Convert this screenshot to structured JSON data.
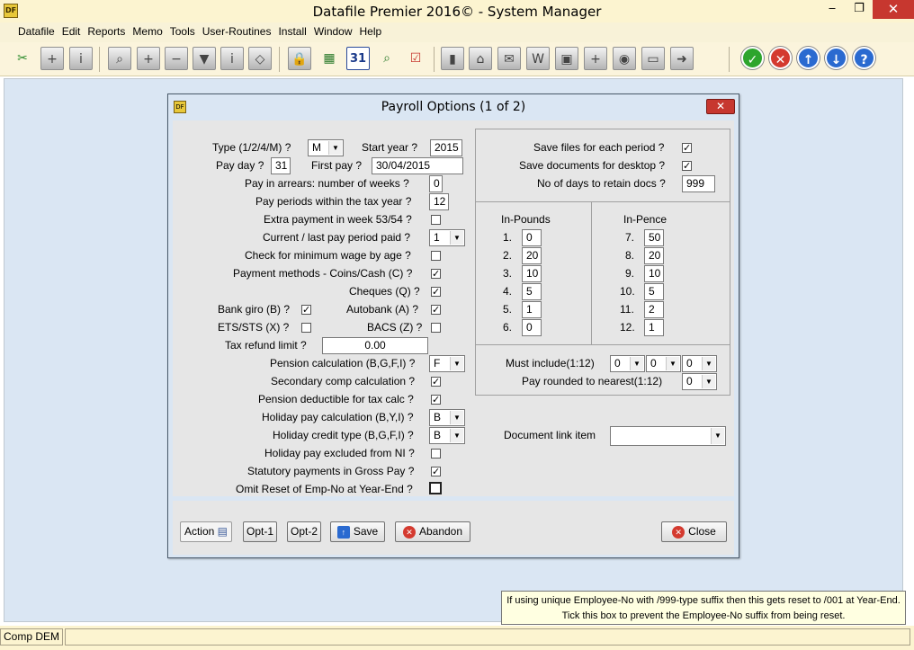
{
  "window": {
    "title": "Datafile  Premier 2016©  - System Manager",
    "app_icon_text": "DF"
  },
  "menu": [
    "Datafile",
    "Edit",
    "Reports",
    "Memo",
    "Tools",
    "User-Routines",
    "Install",
    "Window",
    "Help"
  ],
  "toolbar": {
    "calendar_day": "31"
  },
  "dialog": {
    "title": "Payroll Options (1 of 2)",
    "close_x": "✕",
    "left": {
      "type_label": "Type (1/2/4/M) ?",
      "type_value": "M",
      "start_year_label": "Start year ?",
      "start_year_value": "2015",
      "pay_day_label": "Pay day ?",
      "pay_day_value": "31",
      "first_pay_label": "First pay ?",
      "first_pay_value": "30/04/2015",
      "arrears_label": "Pay in arrears: number of weeks ?",
      "arrears_value": "0",
      "periods_label": "Pay periods within the tax year ?",
      "periods_value": "12",
      "extra_label": "Extra payment in week 53/54 ?",
      "extra_checked": false,
      "current_label": "Current / last pay period paid ?",
      "current_value": "1",
      "minwage_label": "Check for minimum wage by age ?",
      "minwage_checked": false,
      "coins_label": "Payment methods - Coins/Cash (C) ?",
      "coins_checked": true,
      "cheques_label": "Cheques (Q) ?",
      "cheques_checked": true,
      "giro_label": "Bank giro (B) ?",
      "giro_checked": true,
      "autobank_label": "Autobank (A) ?",
      "autobank_checked": true,
      "ets_label": "ETS/STS (X) ?",
      "ets_checked": false,
      "bacs_label": "BACS (Z) ?",
      "bacs_checked": false,
      "refund_label": "Tax refund limit ?",
      "refund_value": "0.00",
      "pension_label": "Pension calculation (B,G,F,I) ?",
      "pension_value": "F",
      "secondary_label": "Secondary comp calculation ?",
      "secondary_checked": true,
      "pension_ded_label": "Pension deductible for tax calc ?",
      "pension_ded_checked": true,
      "holiday_calc_label": "Holiday pay calculation (B,Y,I) ?",
      "holiday_calc_value": "B",
      "holiday_credit_label": "Holiday credit type (B,G,F,I) ?",
      "holiday_credit_value": "B",
      "holiday_ni_label": "Holiday pay excluded from NI ?",
      "holiday_ni_checked": false,
      "statutory_label": "Statutory payments in Gross Pay ?",
      "statutory_checked": true,
      "omit_label": "Omit Reset of Emp-No at Year-End ?",
      "omit_checked": false
    },
    "right": {
      "save_files_label": "Save files for each period ?",
      "save_files_checked": true,
      "save_docs_label": "Save documents for desktop ?",
      "save_docs_checked": true,
      "retain_label": "No of days to retain docs ?",
      "retain_value": "999",
      "pounds_header": "In-Pounds",
      "pence_header": "In-Pence",
      "pounds": [
        {
          "n": "1.",
          "v": "0"
        },
        {
          "n": "2.",
          "v": "20"
        },
        {
          "n": "3.",
          "v": "10"
        },
        {
          "n": "4.",
          "v": "5"
        },
        {
          "n": "5.",
          "v": "1"
        },
        {
          "n": "6.",
          "v": "0"
        }
      ],
      "pence": [
        {
          "n": "7.",
          "v": "50"
        },
        {
          "n": "8.",
          "v": "20"
        },
        {
          "n": "9.",
          "v": "10"
        },
        {
          "n": "10.",
          "v": "5"
        },
        {
          "n": "11.",
          "v": "2"
        },
        {
          "n": "12.",
          "v": "1"
        }
      ],
      "must_include_label": "Must include(1:12)",
      "must_include_values": [
        "0",
        "0",
        "0"
      ],
      "rounded_label": "Pay rounded to nearest(1:12)",
      "rounded_value": "0",
      "doc_link_label": "Document link item",
      "doc_link_value": ""
    },
    "buttons": {
      "action": "Action",
      "opt1": "Opt-1",
      "opt2": "Opt-2",
      "save": "Save",
      "abandon": "Abandon",
      "close": "Close"
    }
  },
  "status": {
    "company": "Comp DEM"
  },
  "tooltip": {
    "line1": "If using unique Employee-No with /999-type suffix then this gets reset to /001 at Year-End.",
    "line2": "Tick this box to prevent the Employee-No suffix from being reset."
  },
  "colors": {
    "titlebar": "#fcf4d0",
    "workspace": "#dae6f3",
    "close_red": "#c7372f"
  }
}
